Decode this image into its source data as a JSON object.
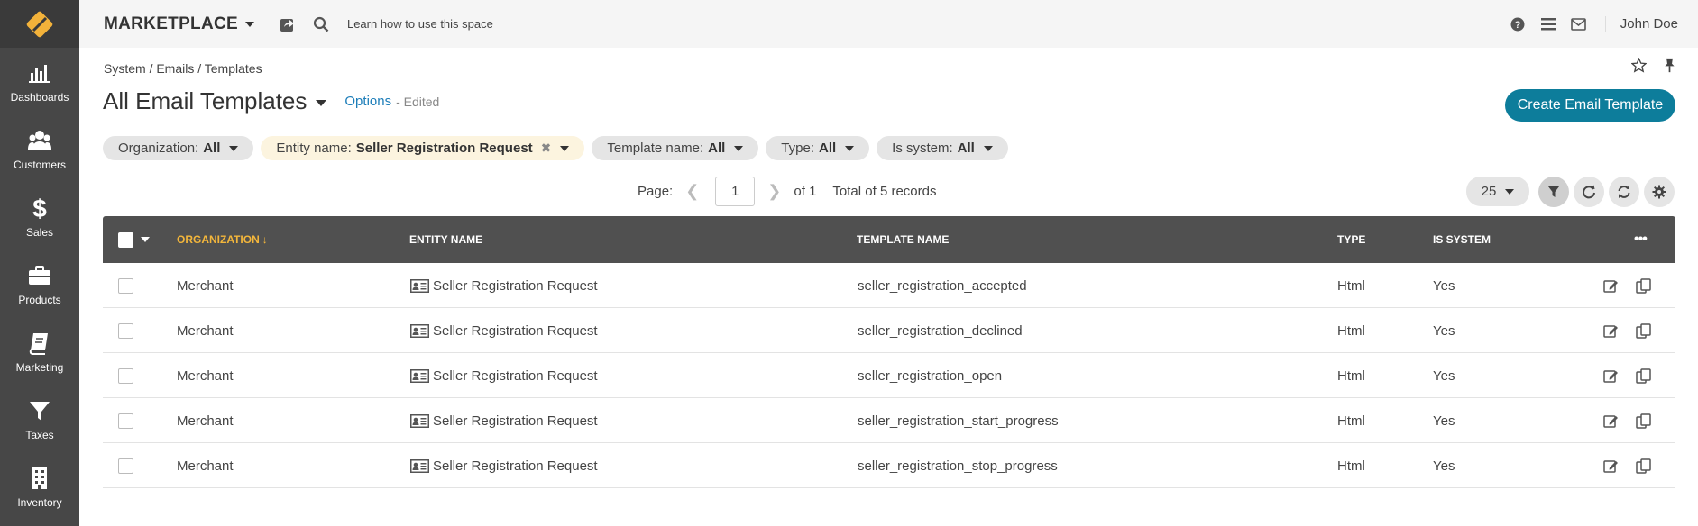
{
  "topbar": {
    "app_title": "MARKETPLACE",
    "help_link": "Learn how to use this space",
    "user_name": "John Doe"
  },
  "sidebar": {
    "items": [
      {
        "label": "Dashboards",
        "icon": "bar-chart-icon"
      },
      {
        "label": "Customers",
        "icon": "users-icon"
      },
      {
        "label": "Sales",
        "icon": "dollar-icon"
      },
      {
        "label": "Products",
        "icon": "briefcase-icon"
      },
      {
        "label": "Marketing",
        "icon": "book-icon"
      },
      {
        "label": "Taxes",
        "icon": "filter-icon"
      },
      {
        "label": "Inventory",
        "icon": "building-icon"
      }
    ]
  },
  "breadcrumb": "System / Emails / Templates",
  "page": {
    "title": "All Email Templates",
    "options": "Options",
    "edited": "- Edited",
    "create_button": "Create Email Template"
  },
  "filters": [
    {
      "label": "Organization:",
      "value": "All"
    },
    {
      "label": "Entity name:",
      "value": "Seller Registration Request"
    },
    {
      "label": "Template name:",
      "value": "All"
    },
    {
      "label": "Type:",
      "value": "All"
    },
    {
      "label": "Is system:",
      "value": "All"
    }
  ],
  "pager": {
    "page_label": "Page:",
    "current_page": "1",
    "of_label": "of 1",
    "total": "Total of 5 records",
    "per_page": "25"
  },
  "table": {
    "headers": {
      "organization": "ORGANIZATION",
      "entity_name": "ENTITY NAME",
      "template_name": "TEMPLATE NAME",
      "type": "TYPE",
      "is_system": "IS SYSTEM"
    },
    "rows": [
      {
        "organization": "Merchant",
        "entity_name": "Seller Registration Request",
        "template_name": "seller_registration_accepted",
        "type": "Html",
        "is_system": "Yes"
      },
      {
        "organization": "Merchant",
        "entity_name": "Seller Registration Request",
        "template_name": "seller_registration_declined",
        "type": "Html",
        "is_system": "Yes"
      },
      {
        "organization": "Merchant",
        "entity_name": "Seller Registration Request",
        "template_name": "seller_registration_open",
        "type": "Html",
        "is_system": "Yes"
      },
      {
        "organization": "Merchant",
        "entity_name": "Seller Registration Request",
        "template_name": "seller_registration_start_progress",
        "type": "Html",
        "is_system": "Yes"
      },
      {
        "organization": "Merchant",
        "entity_name": "Seller Registration Request",
        "template_name": "seller_registration_stop_progress",
        "type": "Html",
        "is_system": "Yes"
      }
    ]
  },
  "colors": {
    "sidebar": "#474747",
    "accent": "#0d7d9b",
    "sorted_header": "#f3b63b",
    "logo": "#f3b23a"
  }
}
